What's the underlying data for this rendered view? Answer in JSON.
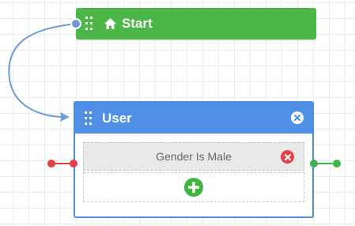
{
  "start_node": {
    "label": "Start",
    "icon": "home-icon",
    "color": "#4cb648"
  },
  "user_node": {
    "label": "User",
    "header_color": "#4f90e6",
    "border_color": "#4a8fe2",
    "conditions": [
      {
        "label": "Gender Is Male"
      }
    ],
    "add_icon": "plus-circle-icon"
  },
  "ports": {
    "input_color": "#e53e3e",
    "output_color": "#3db54a",
    "connector_color": "#6b9bd6"
  }
}
